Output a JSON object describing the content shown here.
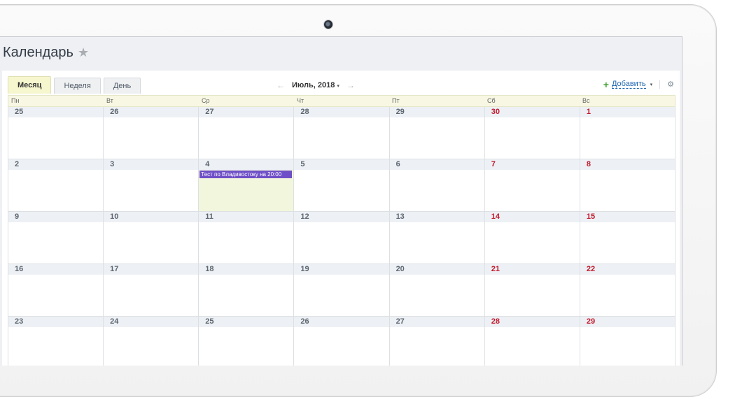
{
  "header": {
    "title": "Календарь",
    "star_icon": "★"
  },
  "tabs": [
    {
      "label": "Месяц",
      "active": true
    },
    {
      "label": "Неделя",
      "active": false
    },
    {
      "label": "День",
      "active": false
    }
  ],
  "nav": {
    "prev": "←",
    "month": "Июль, 2018",
    "caret": "▾",
    "next": "→"
  },
  "toolbar": {
    "plus": "+",
    "add_label": "Добавить",
    "add_caret": "▾",
    "settings_icon": "⚙"
  },
  "weekdays": [
    "Пн",
    "Вт",
    "Ср",
    "Чт",
    "Пт",
    "Сб",
    "Вс"
  ],
  "weeks": [
    [
      "25",
      "26",
      "27",
      "28",
      "29",
      "30",
      "1"
    ],
    [
      "2",
      "3",
      "4",
      "5",
      "6",
      "7",
      "8"
    ],
    [
      "9",
      "10",
      "11",
      "12",
      "13",
      "14",
      "15"
    ],
    [
      "16",
      "17",
      "18",
      "19",
      "20",
      "21",
      "22"
    ],
    [
      "23",
      "24",
      "25",
      "26",
      "27",
      "28",
      "29"
    ]
  ],
  "event": {
    "title": "Тест по Владивостоку на 20:00",
    "color": "#6f4fc7"
  },
  "colors": {
    "weekend": "#c3172b",
    "today": "#f2f6dc",
    "active_tab": "#f6f6cf"
  }
}
